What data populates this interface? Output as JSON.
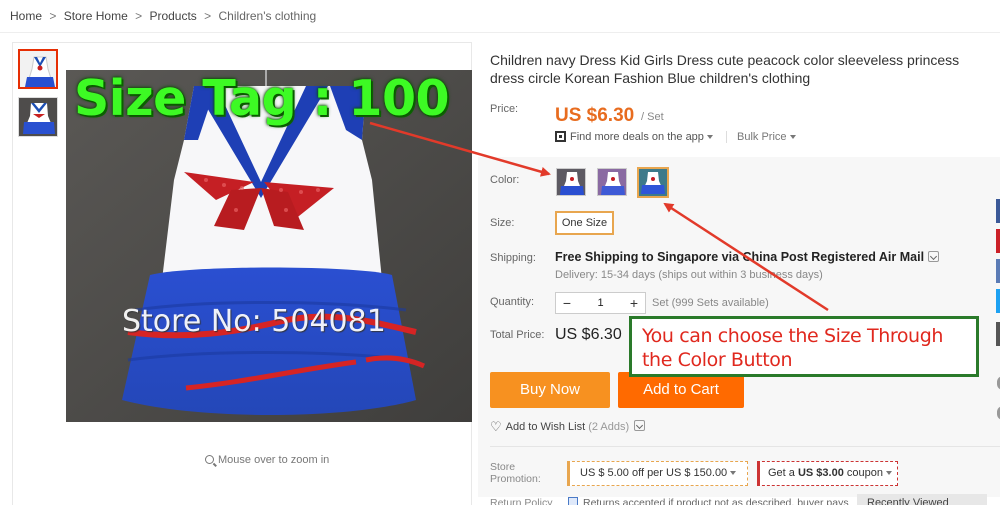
{
  "breadcrumb": {
    "items": [
      "Home",
      "Store Home",
      "Products"
    ],
    "current": "Children's clothing",
    "separator": ">"
  },
  "gallery": {
    "zoom_hint": "Mouse over to zoom in",
    "overlay_size_tag": "Size Tag : 100",
    "overlay_store": "Store No: 504081"
  },
  "product": {
    "title": "Children navy Dress Kid Girls Dress cute peacock color sleeveless princess dress circle Korean Fashion Blue children's clothing",
    "price_label": "Price:",
    "price": "US $6.30",
    "price_unit": "/ Set",
    "app_deals": "Find more deals on the app",
    "bulk_price": "Bulk Price",
    "color_label": "Color:",
    "size_label": "Size:",
    "size_value": "One Size",
    "shipping_label": "Shipping:",
    "shipping_text": "Free Shipping to Singapore via China Post Registered Air Mail",
    "delivery_text": "Delivery: 15-34 days (ships out within 3 business days)",
    "quantity_label": "Quantity:",
    "quantity_value": "1",
    "qty_minus": "−",
    "qty_plus": "+",
    "quantity_available": "Set (999 Sets available)",
    "total_label": "Total Price:",
    "total_price": "US $6.30",
    "buy_now": "Buy Now",
    "add_to_cart": "Add to Cart",
    "wishlist": "Add to Wish List",
    "wishlist_count": "(2 Adds)",
    "store_promo_label_1": "Store",
    "store_promo_label_2": "Promotion:",
    "promo_1": "US $ 5.00 off per US $ 150.00",
    "promo_2_prefix": "Get a ",
    "promo_2_amount": "US $3.00",
    "promo_2_suffix": " coupon",
    "return_label": "Return Policy",
    "return_text": "Returns accepted if product not as described, buyer pays",
    "recently_viewed": "Recently Viewed"
  },
  "annotation": {
    "text": "You can choose the Size Through the Color Button"
  },
  "colors": {
    "price": "#e86c1f",
    "buy_now": "#f79120",
    "add_to_cart": "#ff6a00",
    "selected_border": "#e8a64f",
    "annotation_border": "#2a7a2a",
    "annotation_text": "#e0281e",
    "overlay_green": "#3dfa24"
  },
  "side_tabs": [
    "#3b5998",
    "#cb2027",
    "#5b7bb5",
    "#1da1f2",
    "#555555"
  ]
}
